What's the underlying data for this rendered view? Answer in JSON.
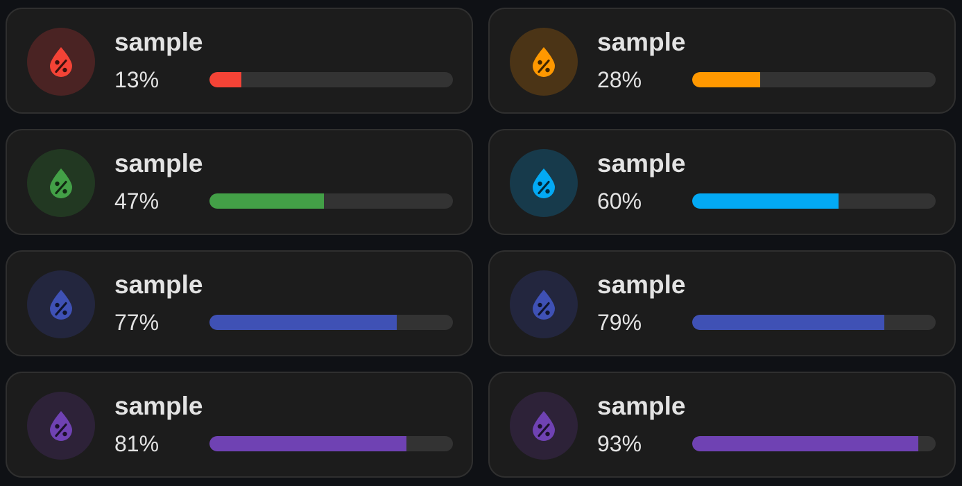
{
  "cards": [
    {
      "title": "sample",
      "value_text": "13%",
      "level": 0.13,
      "icon": "humidity-drop-icon",
      "color": "#f44336",
      "circle_bg": "#4a2323"
    },
    {
      "title": "sample",
      "value_text": "28%",
      "level": 0.28,
      "icon": "humidity-drop-icon",
      "color": "#ff9800",
      "circle_bg": "#4b3416"
    },
    {
      "title": "sample",
      "value_text": "47%",
      "level": 0.47,
      "icon": "humidity-drop-icon",
      "color": "#43a047",
      "circle_bg": "#223822"
    },
    {
      "title": "sample",
      "value_text": "60%",
      "level": 0.6,
      "icon": "humidity-drop-icon",
      "color": "#03a9f4",
      "circle_bg": "#173a4b"
    },
    {
      "title": "sample",
      "value_text": "77%",
      "level": 0.77,
      "icon": "humidity-drop-icon",
      "color": "#3f51b5",
      "circle_bg": "#23263e"
    },
    {
      "title": "sample",
      "value_text": "79%",
      "level": 0.79,
      "icon": "humidity-drop-icon",
      "color": "#3f51b5",
      "circle_bg": "#23263e"
    },
    {
      "title": "sample",
      "value_text": "81%",
      "level": 0.81,
      "icon": "humidity-drop-icon",
      "color": "#6f42b3",
      "circle_bg": "#2d2238"
    },
    {
      "title": "sample",
      "value_text": "93%",
      "level": 0.93,
      "icon": "humidity-drop-icon",
      "color": "#6f42b3",
      "circle_bg": "#2d2238"
    }
  ]
}
